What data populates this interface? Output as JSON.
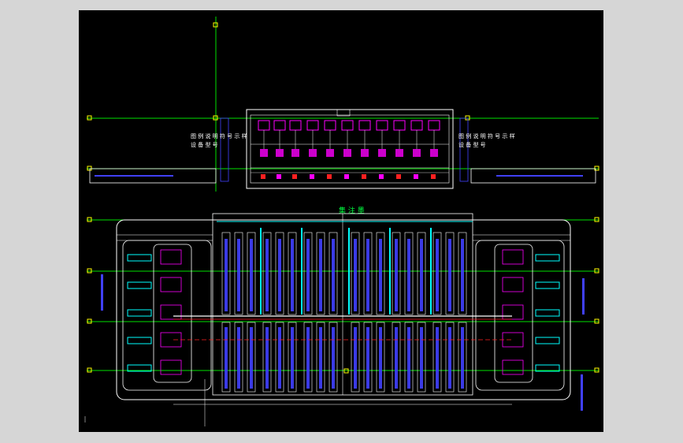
{
  "app": {
    "background": "#d6d6d6",
    "viewport_background": "#000000"
  },
  "drawing": {
    "room_label": "集 注 墨",
    "note_left_line1": "图 例 说 明 符 号 示 样",
    "note_left_line2": "设 备 型 号",
    "note_right_line1": "图 例 说 明 符 号 示 样",
    "note_right_line2": "设 备 型 号",
    "colors": {
      "grid": "#00e000",
      "wall": "#ffffff",
      "equipment": "#ff00ff",
      "cable": "#4040ff",
      "rack": "#00ffff",
      "pipe": "#ff2020",
      "marker": "#ffff00"
    }
  }
}
